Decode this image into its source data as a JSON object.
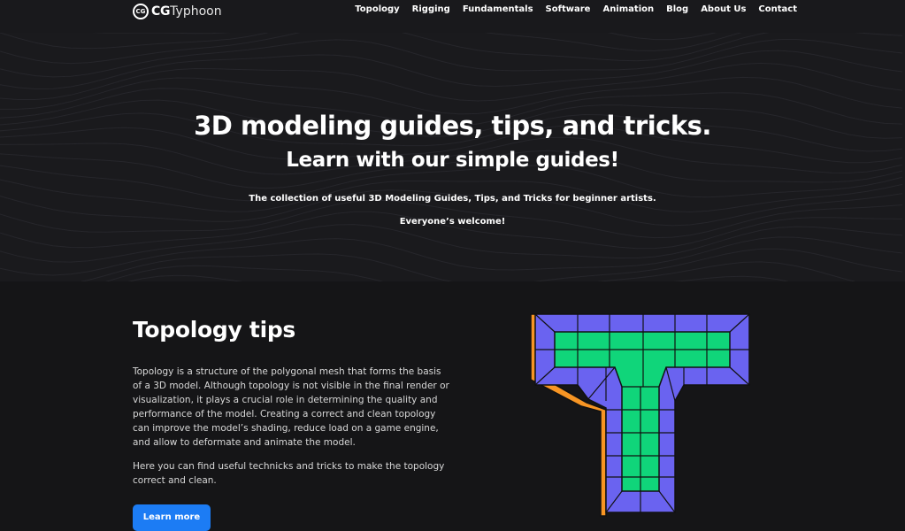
{
  "header": {
    "logo_mark": "CG",
    "logo_bold": "CG",
    "logo_rest": "Typhoon",
    "nav": [
      "Topology",
      "Rigging",
      "Fundamentals",
      "Software",
      "Animation",
      "Blog",
      "About Us",
      "Contact"
    ]
  },
  "hero": {
    "title": "3D modeling guides, tips, and tricks.",
    "subtitle": "Learn with our simple guides!",
    "description": "The collection of useful 3D Modeling Guides, Tips, and Tricks for beginner artists.",
    "welcome": "Everyone’s welcome!"
  },
  "topology": {
    "title": "Topology tips",
    "paragraph1": "Topology is a structure of the polygonal mesh that forms the basis of a 3D model. Although topology is not visible in the final render or visualization, it plays a crucial role in determining the quality and performance of the model. Creating a correct and clean topology can improve the model’s shading, reduce load on a game engine, and allow to deformate and animate the model.",
    "paragraph2": "Here you can find useful technicks and tricks to make the topology correct and clean.",
    "button": "Learn more",
    "illustration_icon": "topology-t-icon"
  },
  "colors": {
    "page_bg": "#151517",
    "hero_bg": "#1a1a1d",
    "button": "#1c7cf4",
    "mesh_green": "#10d57a",
    "mesh_purple": "#6a63f0",
    "mesh_orange": "#f79524"
  }
}
